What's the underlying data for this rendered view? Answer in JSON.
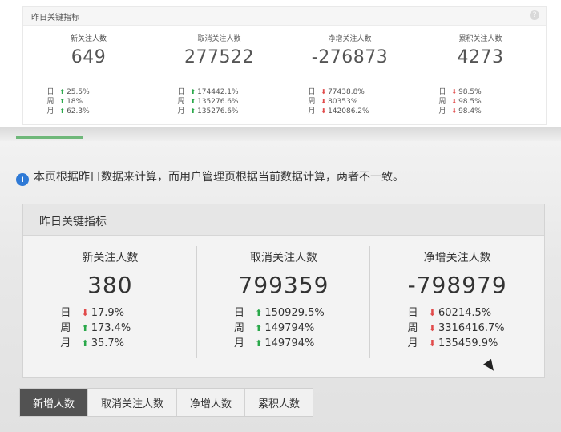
{
  "top": {
    "title": "昨日关键指标",
    "help_icon": "?",
    "metrics": [
      {
        "label": "新关注人数",
        "value": "649",
        "changes": [
          {
            "period": "日",
            "dir": "up",
            "value": "25.5%"
          },
          {
            "period": "周",
            "dir": "up",
            "value": "18%"
          },
          {
            "period": "月",
            "dir": "up",
            "value": "62.3%"
          }
        ]
      },
      {
        "label": "取消关注人数",
        "value": "277522",
        "changes": [
          {
            "period": "日",
            "dir": "up",
            "value": "174442.1%"
          },
          {
            "period": "周",
            "dir": "up",
            "value": "135276.6%"
          },
          {
            "period": "月",
            "dir": "up",
            "value": "135276.6%"
          }
        ]
      },
      {
        "label": "净增关注人数",
        "value": "-276873",
        "changes": [
          {
            "period": "日",
            "dir": "down",
            "value": "77438.8%"
          },
          {
            "period": "周",
            "dir": "down",
            "value": "80353%"
          },
          {
            "period": "月",
            "dir": "down",
            "value": "142086.2%"
          }
        ]
      },
      {
        "label": "累积关注人数",
        "value": "4273",
        "changes": [
          {
            "period": "日",
            "dir": "down",
            "value": "98.5%"
          },
          {
            "period": "周",
            "dir": "down",
            "value": "98.5%"
          },
          {
            "period": "月",
            "dir": "down",
            "value": "98.4%"
          }
        ]
      }
    ]
  },
  "photo": {
    "notice": "本页根据昨日数据来计算，而用户管理页根据当前数据计算，两者不一致。",
    "card_title": "昨日关键指标",
    "metrics": [
      {
        "label": "新关注人数",
        "value": "380",
        "changes": [
          {
            "period": "日",
            "dir": "down",
            "value": "17.9%"
          },
          {
            "period": "周",
            "dir": "up",
            "value": "173.4%"
          },
          {
            "period": "月",
            "dir": "up",
            "value": "35.7%"
          }
        ]
      },
      {
        "label": "取消关注人数",
        "value": "799359",
        "changes": [
          {
            "period": "日",
            "dir": "up",
            "value": "150929.5%"
          },
          {
            "period": "周",
            "dir": "up",
            "value": "149794%"
          },
          {
            "period": "月",
            "dir": "up",
            "value": "149794%"
          }
        ]
      },
      {
        "label": "净增关注人数",
        "value": "-798979",
        "changes": [
          {
            "period": "日",
            "dir": "down",
            "value": "60214.5%"
          },
          {
            "period": "周",
            "dir": "down",
            "value": "3316416.7%"
          },
          {
            "period": "月",
            "dir": "down",
            "value": "135459.9%"
          }
        ]
      }
    ],
    "tabs": [
      "新增人数",
      "取消关注人数",
      "净增人数",
      "累积人数"
    ],
    "active_tab": 0
  }
}
